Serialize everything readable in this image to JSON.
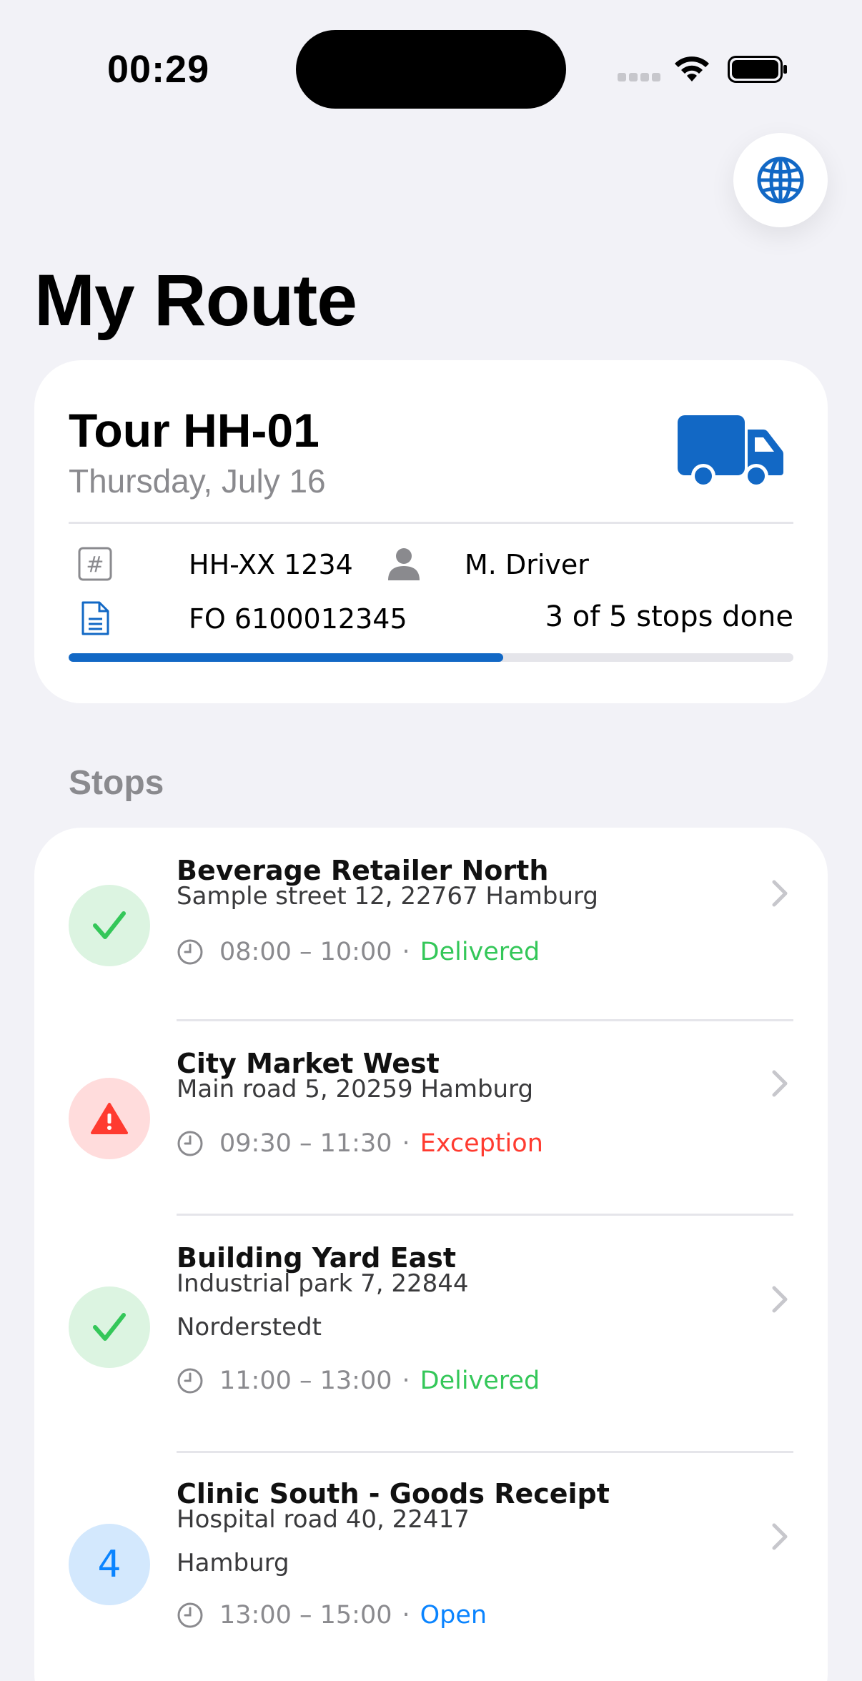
{
  "status_bar": {
    "time": "00:29"
  },
  "page": {
    "title": "My Route"
  },
  "tour": {
    "title": "Tour HH-01",
    "date": "Thursday, July 16",
    "vehicle": "HH-XX 1234",
    "driver": "M. Driver",
    "freight_order": "FO 6100012345",
    "progress_label": "3 of 5 stops done",
    "progress_fraction": 0.6,
    "accent_color": "#1268c5"
  },
  "stops_section": {
    "title": "Stops"
  },
  "stops": [
    {
      "name": "Beverage Retailer North",
      "address": "Sample street 12, 22767 Hamburg",
      "time": "08:00 – 10:00",
      "separator": "·",
      "status": "Delivered",
      "status_color": "#34c759",
      "badge_type": "check",
      "badge_label": ""
    },
    {
      "name": "City Market West",
      "address": "Main road 5, 20259 Hamburg",
      "time": "09:30 – 11:30",
      "separator": "·",
      "status": "Exception",
      "status_color": "#ff3b30",
      "badge_type": "warning",
      "badge_label": ""
    },
    {
      "name": "Building Yard East",
      "address": "Industrial park 7, 22844 Norderstedt",
      "time": "11:00 – 13:00",
      "separator": "·",
      "status": "Delivered",
      "status_color": "#34c759",
      "badge_type": "check",
      "badge_label": ""
    },
    {
      "name": "Clinic South - Goods Receipt",
      "address": "Hospital road 40, 22417 Hamburg",
      "time": "13:00 – 15:00",
      "separator": "·",
      "status": "Open",
      "status_color": "#0a84ff",
      "badge_type": "number",
      "badge_label": "4"
    }
  ],
  "icons": {
    "globe": "globe-icon",
    "truck": "truck-icon",
    "vehicle_plate": "hash-icon",
    "driver": "person-icon",
    "document": "document-icon",
    "clock": "clock-icon",
    "chevron": "chevron-right-icon",
    "check": "checkmark-icon",
    "warning": "warning-triangle-icon"
  }
}
